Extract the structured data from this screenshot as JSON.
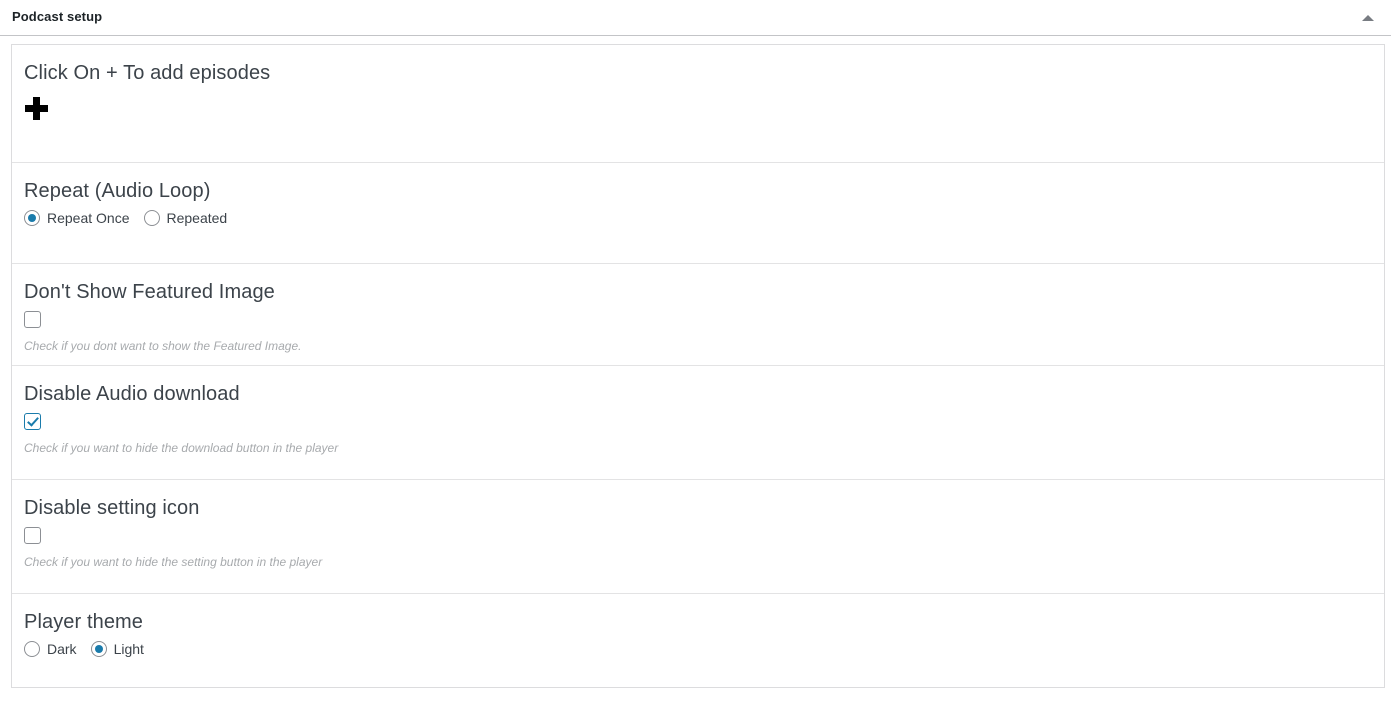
{
  "header": {
    "title": "Podcast setup",
    "toggle_icon": "caret-up-icon"
  },
  "sections": {
    "episodes": {
      "title": "Click On + To add episodes",
      "add_icon": "plus-icon"
    },
    "repeat": {
      "title": "Repeat (Audio Loop)",
      "options": [
        {
          "label": "Repeat Once",
          "selected": true
        },
        {
          "label": "Repeated",
          "selected": false
        }
      ]
    },
    "featured_image": {
      "title": "Don't Show Featured Image",
      "checked": false,
      "description": "Check if you dont want to show the Featured Image."
    },
    "audio_download": {
      "title": "Disable Audio download",
      "checked": true,
      "description": "Check if you want to hide the download button in the player"
    },
    "setting_icon": {
      "title": "Disable setting icon",
      "checked": false,
      "description": "Check if you want to hide the setting button in the player"
    },
    "player_theme": {
      "title": "Player theme",
      "options": [
        {
          "label": "Dark",
          "selected": false
        },
        {
          "label": "Light",
          "selected": true
        }
      ]
    }
  },
  "colors": {
    "accent": "#1a7bab",
    "heading": "#3c434a",
    "description": "#a7aaad",
    "border": "#dcdcde",
    "header_border": "#c3c4c7"
  }
}
